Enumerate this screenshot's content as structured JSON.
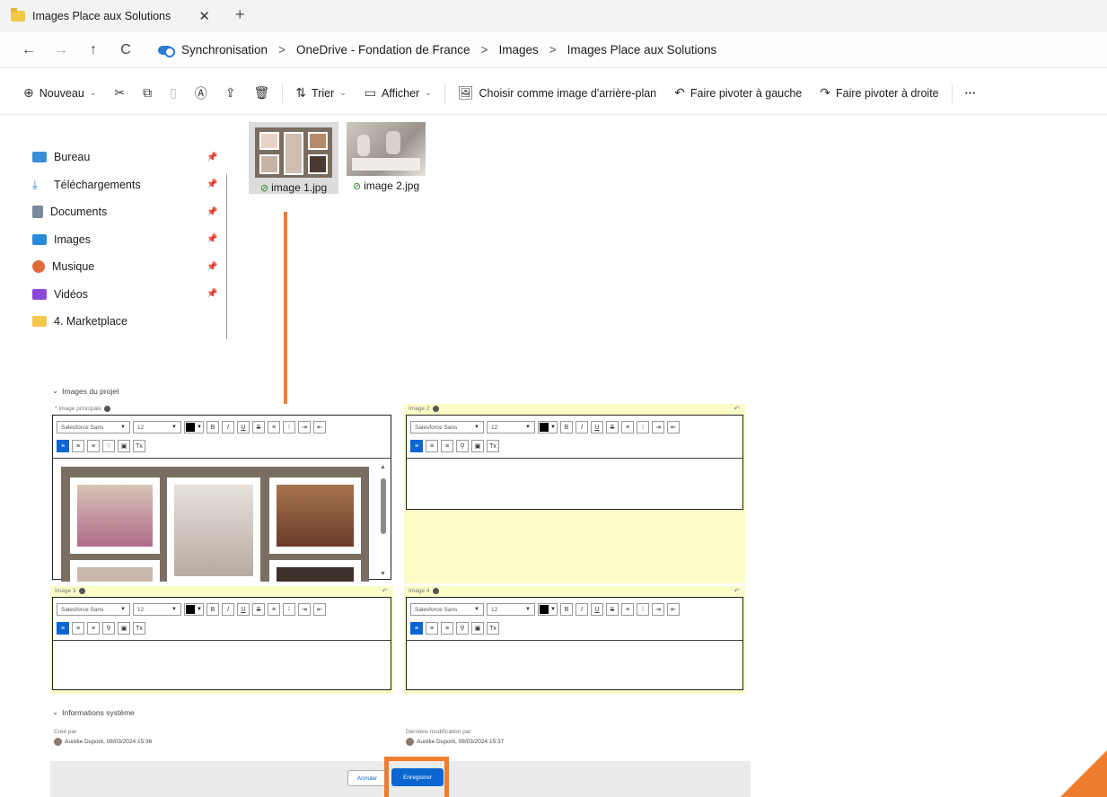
{
  "window": {
    "tab_title": "Images Place aux Solutions",
    "tab_close": "✕",
    "new_tab": "+"
  },
  "nav": {
    "back": "←",
    "forward": "→",
    "up": "↑",
    "refresh": "C",
    "breadcrumbs": [
      "Synchronisation",
      "OneDrive - Fondation de France",
      "Images",
      "Images Place aux Solutions"
    ],
    "separator": ">"
  },
  "toolbar": {
    "new_label": "Nouveau",
    "sort_label": "Trier",
    "view_label": "Afficher",
    "set_background_label": "Choisir comme image d'arrière-plan",
    "rotate_left_label": "Faire pivoter à gauche",
    "rotate_right_label": "Faire pivoter à droite",
    "more_label": "···"
  },
  "sidebar": {
    "items": [
      {
        "label": "Bureau",
        "icon": "desktop-icon",
        "color": "#3a8fd8",
        "pinned": true
      },
      {
        "label": "Téléchargements",
        "icon": "download-icon",
        "color": "#2a7ad4",
        "pinned": true
      },
      {
        "label": "Documents",
        "icon": "document-icon",
        "color": "#7a8a9a",
        "pinned": true
      },
      {
        "label": "Images",
        "icon": "images-icon",
        "color": "#2a8ad8",
        "pinned": true
      },
      {
        "label": "Musique",
        "icon": "music-icon",
        "color": "#e26a3a",
        "pinned": true
      },
      {
        "label": "Vidéos",
        "icon": "video-icon",
        "color": "#8a4ad8",
        "pinned": true
      },
      {
        "label": "4. Marketplace",
        "icon": "folder-icon",
        "color": "#f3c74a",
        "pinned": false
      }
    ]
  },
  "files": [
    {
      "name": "image 1.jpg",
      "selected": true
    },
    {
      "name": "image 2.jpg",
      "selected": false
    }
  ],
  "form": {
    "section_images": "Images du projet",
    "panels": [
      {
        "label": "* Image principale"
      },
      {
        "label": "Image 2"
      },
      {
        "label": "Image 3"
      },
      {
        "label": "Image 4"
      }
    ],
    "font_family": "Salesforce Sans",
    "font_size": "12",
    "section_system": "Informations système",
    "created_by_label": "Créé par",
    "created_by_value": "Aurélie Dupont, 08/03/2024 15:36",
    "modified_by_label": "Dernière modification par",
    "modified_by_value": "Aurélie Dupont, 08/03/2024 15:37",
    "cancel_label": "Annuler",
    "save_label": "Enregistrer"
  },
  "colors": {
    "accent_orange": "#ef7d2f",
    "salesforce_blue": "#0b66d1",
    "panel_yellow": "#fbfcc7"
  }
}
